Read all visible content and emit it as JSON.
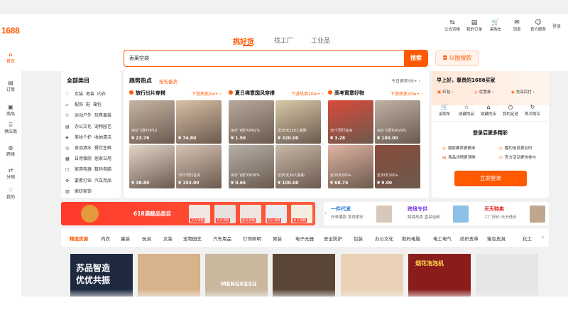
{
  "logo": "1688",
  "left_nav": [
    {
      "label": "首页",
      "icon": "home-icon",
      "glyph": "⌂"
    },
    {
      "label": "订单",
      "icon": "order-icon",
      "glyph": "▤"
    },
    {
      "label": "商品",
      "icon": "product-icon",
      "glyph": "▣"
    },
    {
      "label": "供应商",
      "icon": "supplier-icon",
      "glyph": "⌸"
    },
    {
      "label": "跨境",
      "icon": "globe-icon",
      "glyph": "◍"
    },
    {
      "label": "分销",
      "icon": "distribution-icon",
      "glyph": "⇄"
    },
    {
      "label": "我的",
      "icon": "shield-user-icon",
      "glyph": "♡"
    }
  ],
  "top_icons": [
    {
      "label": "公式切换",
      "glyph": "⇆"
    },
    {
      "label": "我的订单",
      "glyph": "▤"
    },
    {
      "label": "采购车",
      "glyph": "🛒"
    },
    {
      "label": "消息",
      "glyph": "✉"
    },
    {
      "label": "官方服务",
      "glyph": "☺"
    }
  ],
  "login_link": "登录",
  "search_tabs": [
    "挑好货",
    "找工厂",
    "工业品"
  ],
  "search": {
    "value": "香薰空袋",
    "button": "搜索",
    "image_search": "以图搜款"
  },
  "categories": {
    "title": "全部类目",
    "rows": [
      {
        "glyph": "♡",
        "items": [
          "女装",
          "男装",
          "内衣"
        ]
      },
      {
        "glyph": "▱",
        "items": [
          "配饰",
          "鞋",
          "箱包"
        ]
      },
      {
        "glyph": "⚇",
        "items": [
          "运动户外",
          "玩具童装"
        ]
      },
      {
        "glyph": "▤",
        "items": [
          "办公文化",
          "宠物园艺"
        ]
      },
      {
        "glyph": "◈",
        "items": [
          "美妆个护",
          "收纳清洁"
        ]
      },
      {
        "glyph": "◎",
        "items": [
          "食品酒水",
          "餐饮生鲜"
        ]
      },
      {
        "glyph": "▦",
        "items": [
          "日用餐厨",
          "居家日用"
        ]
      },
      {
        "glyph": "▢",
        "items": [
          "家用电器",
          "数码电脑"
        ]
      },
      {
        "glyph": "⚙",
        "items": [
          "要素灯饰",
          "汽车用品"
        ]
      },
      {
        "glyph": "▥",
        "items": [
          "家纺家饰"
        ]
      }
    ]
  },
  "trend": {
    "title": "趋势热点",
    "subtitle": "抢先备货",
    "updated": "今日更新99+",
    "sections": [
      {
        "title": "旅行出片穿搭",
        "more": "下游热卖2w+",
        "tiles": [
          {
            "tag": "买价飞涨TOP10",
            "price": "¥ 23.76"
          },
          {
            "tag": "",
            "price": "¥ 74.80"
          },
          {
            "tag": "",
            "price": "¥ 38.80"
          },
          {
            "tag": "79个同行在买",
            "price": "¥ 153.00"
          }
        ]
      },
      {
        "title": "夏日禅意国风穿搭",
        "more": "下游热卖10w+",
        "tiles": [
          {
            "tag": "买价飞涨TOP82%",
            "price": "¥ 1.90"
          },
          {
            "tag": "近30天120人复购",
            "price": "¥ 320.00"
          },
          {
            "tag": "买价飞涨TOP38%",
            "price": "¥ 0.65"
          },
          {
            "tag": "近30天30人复购",
            "price": "¥ 100.00"
          }
        ]
      },
      {
        "title": "高考寓意好物",
        "more": "下游热卖10w+",
        "tiles": [
          {
            "tag": "30个同行在买",
            "price": "¥ 3.28"
          },
          {
            "tag": "买价飞涨TOP29%",
            "price": "¥ 100.00"
          },
          {
            "tag": "近30天200+",
            "price": "¥ 68.74"
          },
          {
            "tag": "近30天100+",
            "price": "¥ 9.00"
          }
        ]
      }
    ]
  },
  "login_panel": {
    "greeting": "早上好，尊贵的1688买家",
    "chips": [
      {
        "glyph": "▣",
        "label": "红包"
      },
      {
        "glyph": "◎",
        "label": "优惠券"
      },
      {
        "glyph": "◉",
        "label": "先采后付"
      }
    ],
    "icons": [
      {
        "glyph": "🛒",
        "label": "采购车"
      },
      {
        "glyph": "☆",
        "label": "收藏的品"
      },
      {
        "glyph": "⌂",
        "label": "收藏的店"
      },
      {
        "glyph": "◷",
        "label": "我的足迹"
      },
      {
        "glyph": "↻",
        "label": "再次购买"
      }
    ],
    "hint": "登录后更多精彩",
    "features": [
      {
        "glyph": "◎",
        "label": "搜索推荐更精准"
      },
      {
        "glyph": "◷",
        "label": "履约信息更及时"
      },
      {
        "glyph": "▤",
        "label": "商品详情更清晰"
      },
      {
        "glyph": "☑",
        "label": "官方活动更快参与"
      }
    ],
    "button": "立即登录"
  },
  "banner_left": {
    "title": "618满额品类目",
    "cards": [
      "又有满额",
      "热卖满额",
      "超值满额",
      "低价满额",
      "会员满额"
    ]
  },
  "banner_right": [
    {
      "title": "一件代发",
      "sub": "开单爆款 发得更安",
      "color": "#1f6fd1"
    },
    {
      "title": "跨境专供",
      "sub": "跨境热卖 直采包邮",
      "color": "#7b3fe4"
    },
    {
      "title": "天天特卖",
      "sub": "工厂好价 天天低价",
      "color": "#e0201b"
    }
  ],
  "category_tabs": [
    "精选货源",
    "内衣",
    "童装",
    "玩具",
    "女装",
    "宠物园艺",
    "汽车用品",
    "灯饰照明",
    "男装",
    "电子元器",
    "安全防护",
    "包装",
    "办公文化",
    "数码电脑",
    "电工电气",
    "纺织皮革",
    "箱包皮具",
    "化工"
  ],
  "products": [
    {
      "text": "苏品智造\n优优共振",
      "bg": "#1f2a40"
    },
    {
      "text": "",
      "bg": "#d8b28a"
    },
    {
      "text": "MENGKESU",
      "bg": "#c9b79e"
    },
    {
      "text": "",
      "bg": "#5a4536"
    },
    {
      "text": "",
      "bg": "#e9d2b5"
    },
    {
      "text": "烟花泡泡机",
      "bg": "#8b1c1c"
    },
    {
      "text": "",
      "bg": "#e6e6e6"
    }
  ]
}
